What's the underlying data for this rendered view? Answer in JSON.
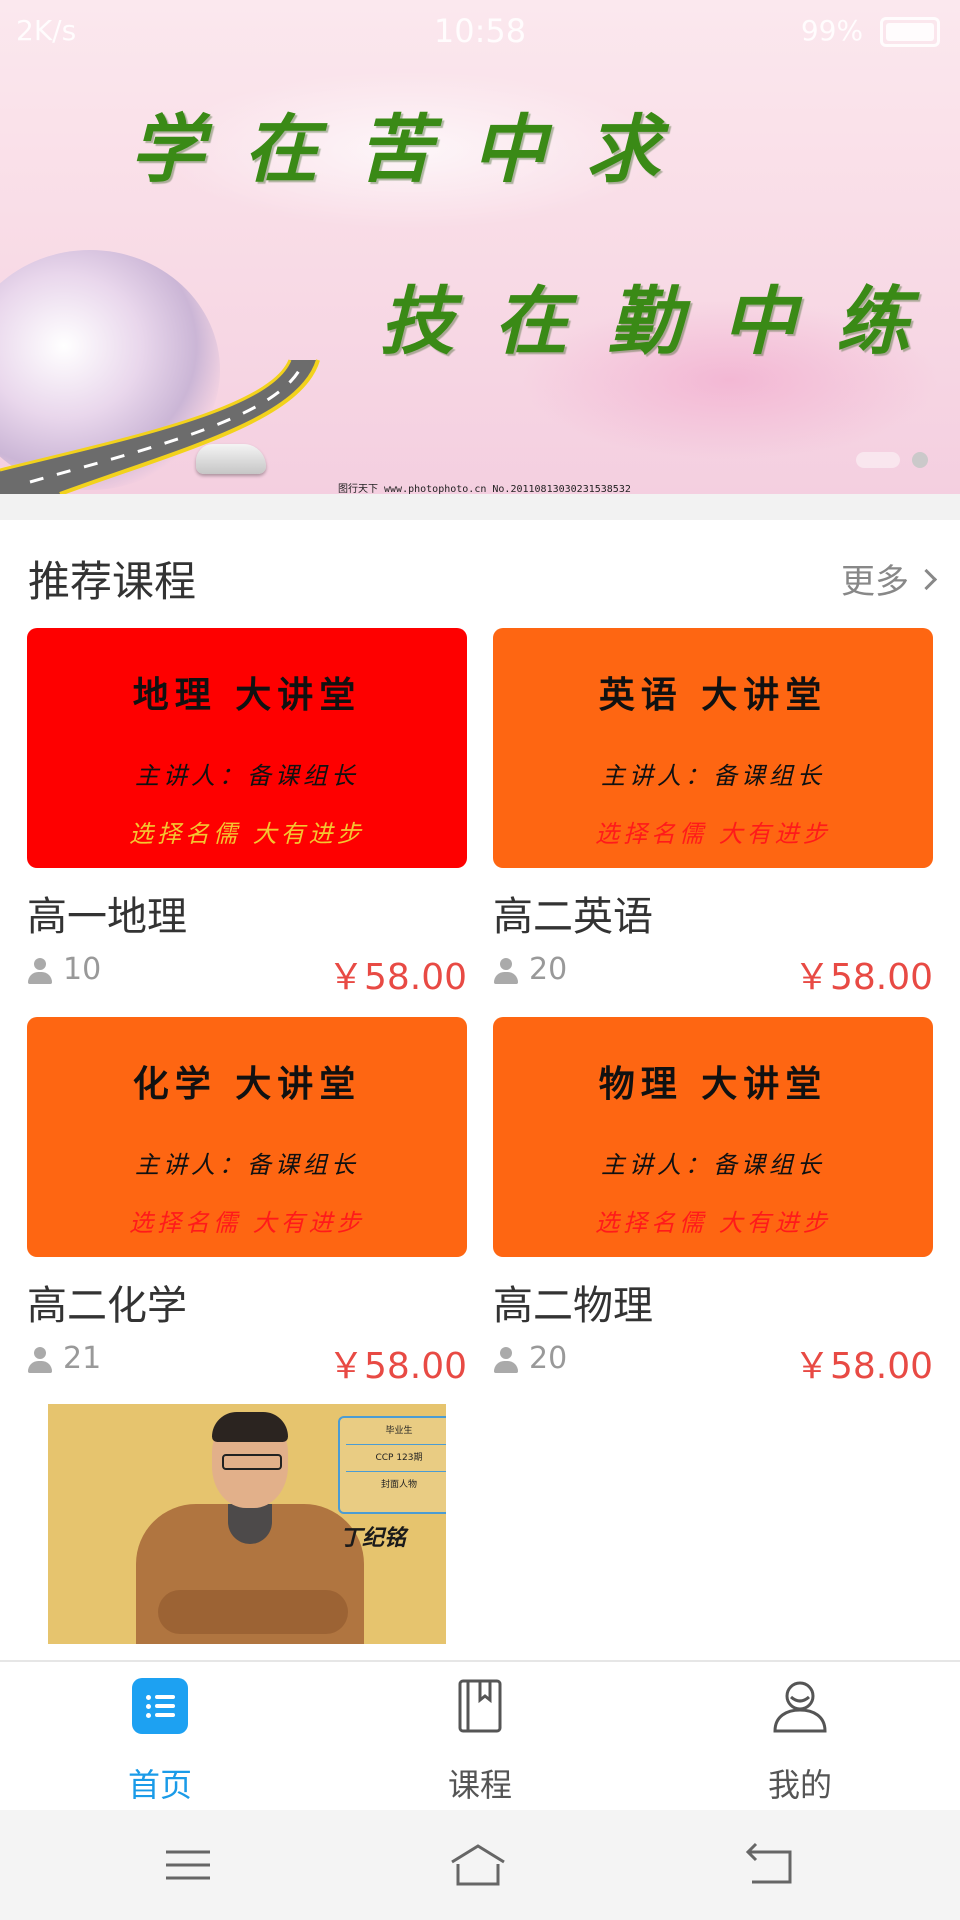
{
  "status_bar": {
    "left": "2K/s",
    "time": "10:58",
    "battery": "99%"
  },
  "banner": {
    "line1": "学在苦中求",
    "line2": "技在勤中练",
    "caption": "图行天下 www.photophoto.cn  No.20110813030231538532"
  },
  "section": {
    "title": "推荐课程",
    "more": "更多"
  },
  "courses": [
    {
      "name": "高一地理",
      "students": "10",
      "price": "￥58.00",
      "thumb": {
        "title": "地理 大讲堂",
        "lecturer": "主讲人：备课组长",
        "slogan": "选择名儒 大有进步",
        "bg": "#fe0000",
        "slogan_color": "#f4c531"
      }
    },
    {
      "name": "高二英语",
      "students": "20",
      "price": "￥58.00",
      "thumb": {
        "title": "英语 大讲堂",
        "lecturer": "主讲人：备课组长",
        "slogan": "选择名儒 大有进步",
        "bg": "#fe6612",
        "slogan_color": "#ff1a1a"
      }
    },
    {
      "name": "高二化学",
      "students": "21",
      "price": "￥58.00",
      "thumb": {
        "title": "化学 大讲堂",
        "lecturer": "主讲人：备课组长",
        "slogan": "选择名儒 大有进步",
        "bg": "#fe6612",
        "slogan_color": "#ff1a1a"
      }
    },
    {
      "name": "高二物理",
      "students": "20",
      "price": "￥58.00",
      "thumb": {
        "title": "物理 大讲堂",
        "lecturer": "主讲人：备课组长",
        "slogan": "选择名儒 大有进步",
        "bg": "#fe6612",
        "slogan_color": "#ff1a1a"
      }
    }
  ],
  "teacher": {
    "badge": [
      "毕业生",
      "CCP 123期",
      "封面人物"
    ],
    "name": "丁纪铭"
  },
  "tabs": [
    {
      "label": "首页",
      "icon": "home-list-icon",
      "active": true
    },
    {
      "label": "课程",
      "icon": "book-icon",
      "active": false
    },
    {
      "label": "我的",
      "icon": "user-icon",
      "active": false
    }
  ],
  "system_nav": [
    "menu-icon",
    "home-icon",
    "back-icon"
  ],
  "colors": {
    "accent": "#1a9be8",
    "price": "#e84a44",
    "banner_text": "#3a8a16"
  }
}
